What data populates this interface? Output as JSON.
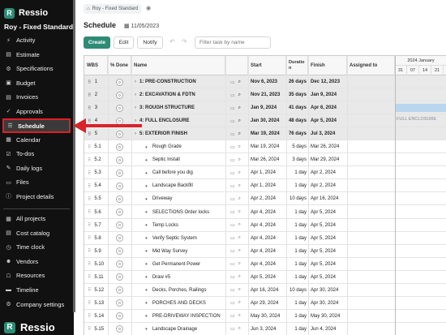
{
  "app": {
    "name": "Ressio",
    "project": "Roy - Fixed Standard"
  },
  "sidebar": {
    "items": [
      {
        "label": "Activity",
        "icon": "activity-icon",
        "glyph": "⚡"
      },
      {
        "label": "Estimate",
        "icon": "estimate-icon",
        "glyph": "▤"
      },
      {
        "label": "Specifications",
        "icon": "specifications-icon",
        "glyph": "⚙"
      },
      {
        "label": "Budget",
        "icon": "budget-icon",
        "glyph": "▣"
      },
      {
        "label": "Invoices",
        "icon": "invoices-icon",
        "glyph": "▤"
      },
      {
        "label": "Approvals",
        "icon": "approvals-icon",
        "glyph": "✓"
      },
      {
        "label": "Schedule",
        "icon": "schedule-icon",
        "glyph": "☰",
        "active": true
      },
      {
        "label": "Calendar",
        "icon": "calendar-icon",
        "glyph": "▦"
      },
      {
        "label": "To-dos",
        "icon": "todos-icon",
        "glyph": "☑"
      },
      {
        "label": "Daily logs",
        "icon": "daily-logs-icon",
        "glyph": "✎"
      },
      {
        "label": "Files",
        "icon": "files-icon",
        "glyph": "▭"
      },
      {
        "label": "Project details",
        "icon": "project-details-icon",
        "glyph": "ⓘ"
      }
    ],
    "global_items": [
      {
        "label": "All projects",
        "icon": "all-projects-icon",
        "glyph": "▦"
      },
      {
        "label": "Cost catalog",
        "icon": "cost-catalog-icon",
        "glyph": "▤"
      },
      {
        "label": "Time clock",
        "icon": "time-clock-icon",
        "glyph": "◷"
      },
      {
        "label": "Vendors",
        "icon": "vendors-icon",
        "glyph": "☻"
      },
      {
        "label": "Resources",
        "icon": "resources-icon",
        "glyph": "☖"
      },
      {
        "label": "Timeline",
        "icon": "timeline-icon",
        "glyph": "▬"
      },
      {
        "label": "Company settings",
        "icon": "company-settings-icon",
        "glyph": "⚙"
      }
    ],
    "bottom_logo": "Ressio"
  },
  "header": {
    "breadcrumb": "Roy - Fixed Standard",
    "title": "Schedule",
    "date": "11/05/2023"
  },
  "toolbar": {
    "create": "Create",
    "edit": "Edit",
    "notify": "Notify",
    "search_placeholder": "Filter task by name"
  },
  "table": {
    "columns": {
      "wbs": "WBS",
      "done": "% Done",
      "name": "Name",
      "start": "Start",
      "duration": "Duratio n",
      "finish": "Finish",
      "assigned": "Assigned to"
    },
    "gantt": {
      "month": "2024 January",
      "days": [
        "31",
        "07",
        "14",
        "21"
      ]
    },
    "rows": [
      {
        "wbs": "1",
        "done": "0",
        "name": "1: PRE-CONSTRUCTION",
        "start": "Nov 6, 2023",
        "duration": "26 days",
        "finish": "Dec 12, 2023",
        "group": true
      },
      {
        "wbs": "2",
        "done": "0",
        "name": "2: EXCAVATION & FDTN",
        "start": "Nov 21, 2023",
        "duration": "35 days",
        "finish": "Jan 9, 2024",
        "group": true
      },
      {
        "wbs": "3",
        "done": "0",
        "name": "3: ROUGH STRUCTURE",
        "start": "Jan 9, 2024",
        "duration": "41 days",
        "finish": "Apr 6, 2024",
        "group": true
      },
      {
        "wbs": "4",
        "done": "0",
        "name": "4: FULL ENCLOSURE",
        "start": "Jan 30, 2024",
        "duration": "48 days",
        "finish": "Apr 5, 2024",
        "group": true,
        "gantt_label": "FULL ENCLOSURE"
      },
      {
        "wbs": "5",
        "done": "0",
        "name": "5: EXTERIOR FINISH",
        "start": "Mar 19, 2024",
        "duration": "76 days",
        "finish": "Jul 3, 2024",
        "group": true
      },
      {
        "wbs": "5.1",
        "done": "0",
        "name": "Rough Grade",
        "start": "Mar 19, 2024",
        "duration": "5 days",
        "finish": "Mar 26, 2024"
      },
      {
        "wbs": "5.2",
        "done": "0",
        "name": "Septic Install",
        "start": "Mar 26, 2024",
        "duration": "3 days",
        "finish": "Mar 29, 2024"
      },
      {
        "wbs": "5.3",
        "done": "0",
        "name": "Call before you dig",
        "start": "Apr 1, 2024",
        "duration": "1 day",
        "finish": "Apr 2, 2024"
      },
      {
        "wbs": "5.4",
        "done": "0",
        "name": "Landscape Backfill",
        "start": "Apr 1, 2024",
        "duration": "1 day",
        "finish": "Apr 2, 2024"
      },
      {
        "wbs": "5.5",
        "done": "0",
        "name": "Driveway",
        "start": "Apr 2, 2024",
        "duration": "10 days",
        "finish": "Apr 16, 2024"
      },
      {
        "wbs": "5.6",
        "done": "0",
        "name": "SELECTIONS Order locks",
        "start": "Apr 4, 2024",
        "duration": "1 day",
        "finish": "Apr 5, 2024"
      },
      {
        "wbs": "5.7",
        "done": "0",
        "name": "Temp Locks",
        "start": "Apr 4, 2024",
        "duration": "1 day",
        "finish": "Apr 5, 2024"
      },
      {
        "wbs": "5.8",
        "done": "0",
        "name": "Verify Septic System",
        "start": "Apr 4, 2024",
        "duration": "1 day",
        "finish": "Apr 5, 2024"
      },
      {
        "wbs": "5.9",
        "done": "0",
        "name": "Mid Way Survey",
        "start": "Apr 4, 2024",
        "duration": "1 day",
        "finish": "Apr 5, 2024"
      },
      {
        "wbs": "5.10",
        "done": "0",
        "name": "Get Permanent Power",
        "start": "Apr 4, 2024",
        "duration": "1 day",
        "finish": "Apr 5, 2024"
      },
      {
        "wbs": "5.11",
        "done": "0",
        "name": "Draw #5",
        "start": "Apr 5, 2024",
        "duration": "1 day",
        "finish": "Apr 5, 2024"
      },
      {
        "wbs": "5.12",
        "done": "0",
        "name": "Decks, Porches, Railings",
        "start": "Apr 16, 2024",
        "duration": "10 days",
        "finish": "Apr 30, 2024"
      },
      {
        "wbs": "5.13",
        "done": "0",
        "name": "PORCHES AND DECKS",
        "start": "Apr 29, 2024",
        "duration": "1 day",
        "finish": "Apr 30, 2024"
      },
      {
        "wbs": "5.14",
        "done": "0",
        "name": "PRE-DRIVEWAY INSPECTION",
        "start": "May 30, 2024",
        "duration": "1 day",
        "finish": "May 30, 2024"
      },
      {
        "wbs": "5.15",
        "done": "0",
        "name": "Landscape Drainage",
        "start": "Jun 3, 2024",
        "duration": "1 day",
        "finish": "Jun 4, 2024"
      }
    ]
  },
  "colors": {
    "accent": "#2e8b76",
    "highlight": "#d9232a",
    "gantt_bar": "#b9d6ee"
  }
}
